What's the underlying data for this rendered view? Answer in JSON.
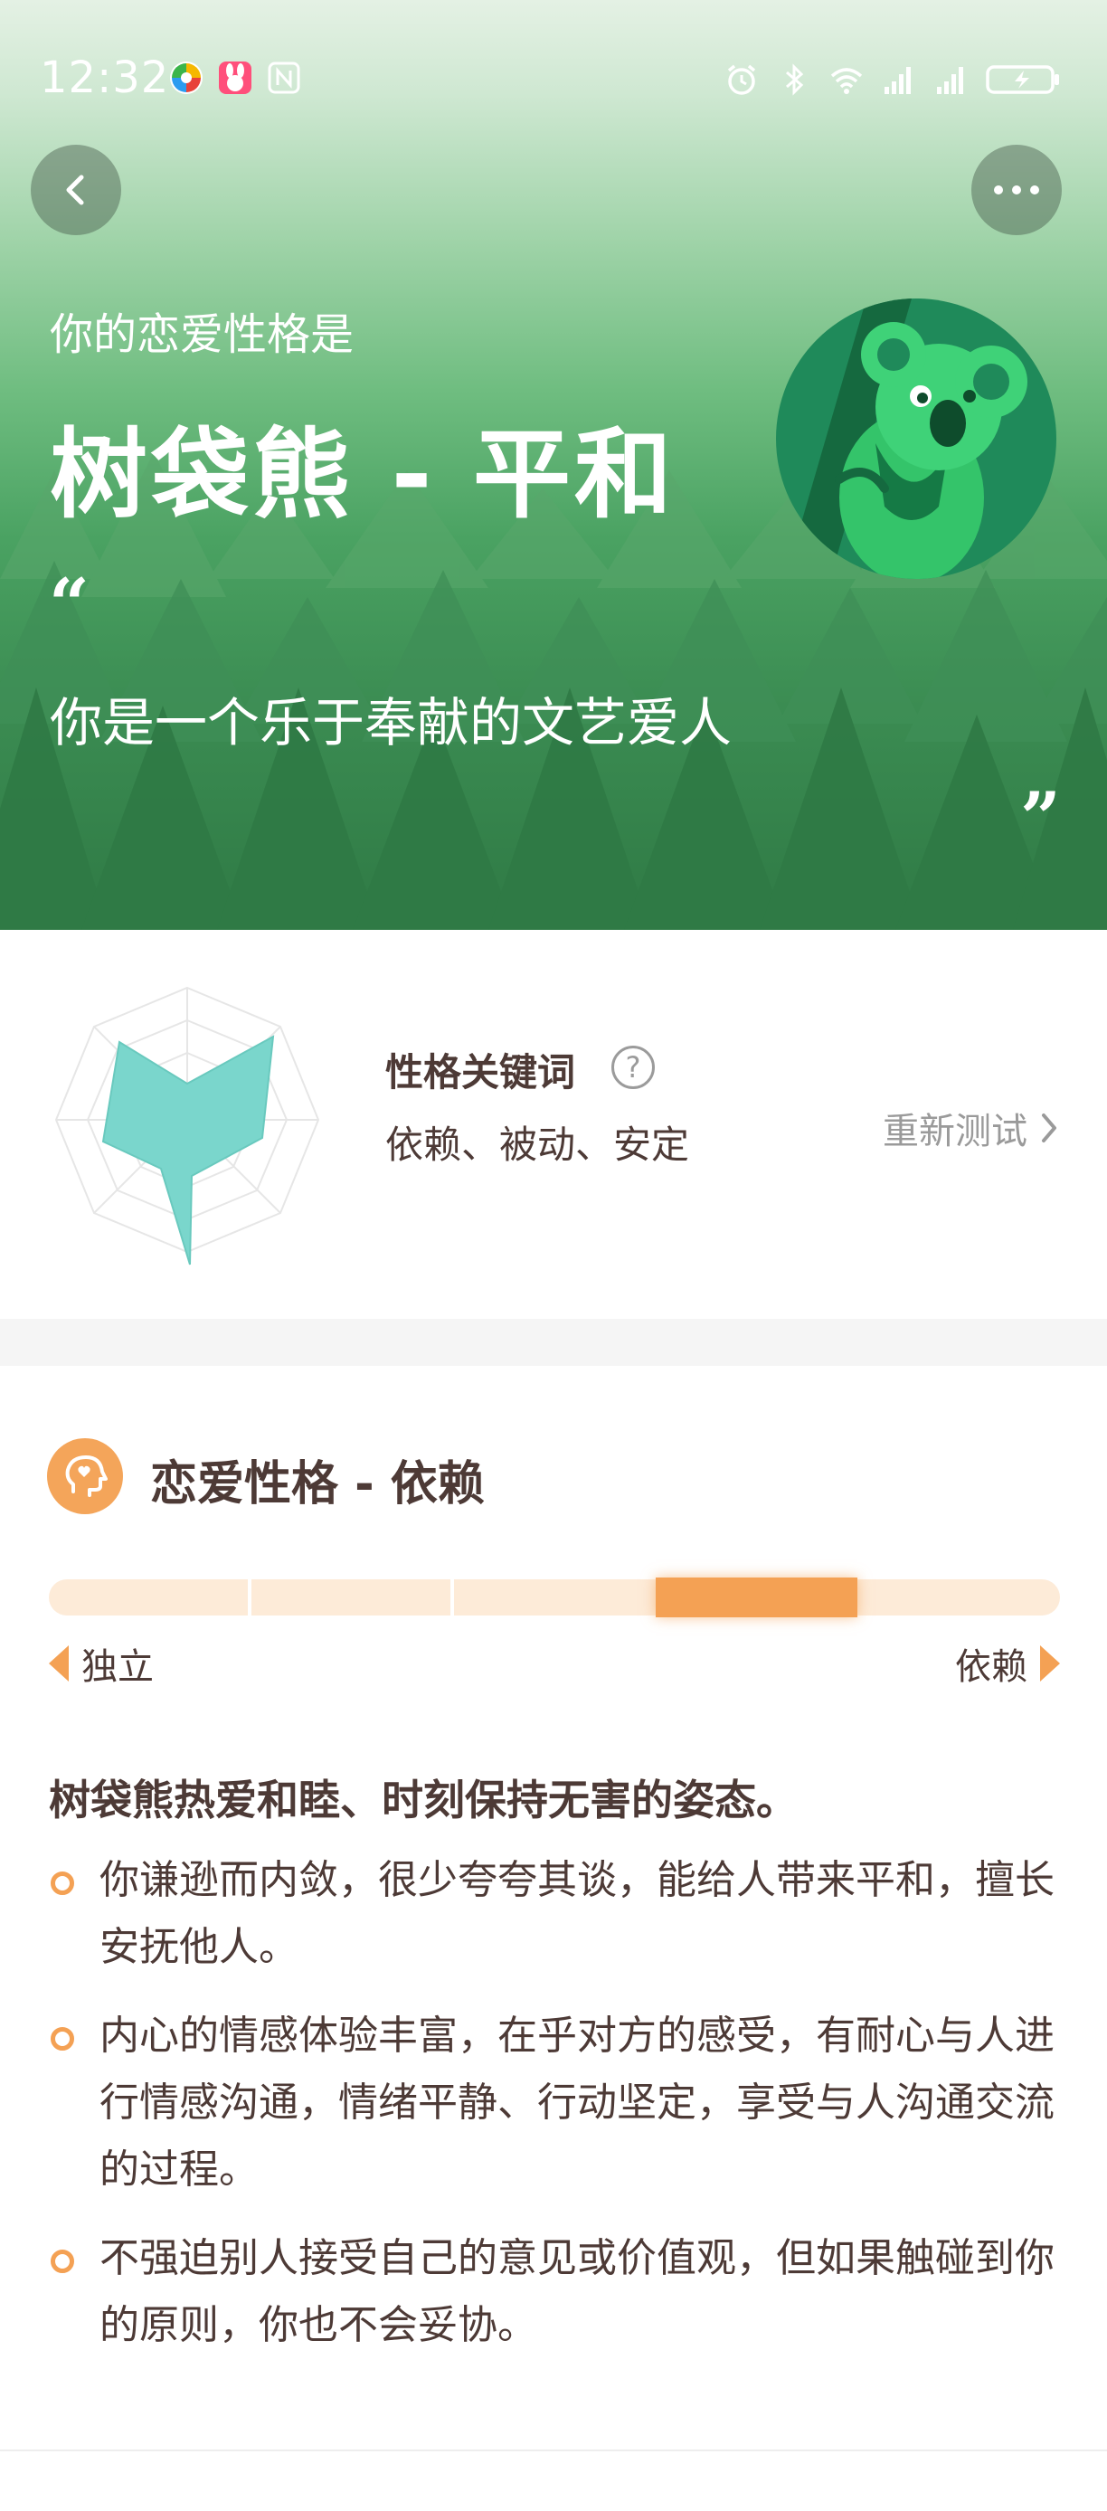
{
  "status_bar": {
    "time": "12:32",
    "left_icons": [
      "app-icon-colorful",
      "app-icon-rabbit",
      "nfc-icon"
    ],
    "right_icons": [
      "alarm-icon",
      "bluetooth-icon",
      "wifi-icon",
      "signal-icon",
      "signal-icon",
      "battery-icon"
    ]
  },
  "header": {
    "back_icon": "chevron-left-icon",
    "more_icon": "more-dots-icon"
  },
  "hero": {
    "subtitle": "你的恋爱性格是",
    "title": "树袋熊 - 平和",
    "quote_open": "“",
    "quote_text": "你是一个乐于奉献的文艺爱人",
    "quote_close": "”",
    "avatar_icon": "koala-avatar",
    "accent_color": "#3aa05a"
  },
  "keywords": {
    "title": "性格关键词",
    "help_icon": "question-circle-icon",
    "help_symbol": "?",
    "values": "依赖、被动、安定",
    "retest_label": "重新测试",
    "retest_icon": "chevron-right-icon",
    "radar_color": "#7ad6cc"
  },
  "personality": {
    "icon": "heart-head-icon",
    "title": "恋爱性格 - 依赖",
    "scale": {
      "left_label": "独立",
      "right_label": "依赖",
      "segments": 5,
      "active_segment": 4,
      "active_color": "#f4a154",
      "track_color": "#fdebd8"
    },
    "summary": "树袋熊热爱和睦、时刻保持无害的姿态。",
    "points": [
      "你谦逊而内敛，很少夸夸其谈，能给人带来平和，擅长安抚他人。",
      "内心的情感体验丰富，在乎对方的感受，有耐心与人进行情感沟通，情绪平静、行动坚定，享受与人沟通交流的过程。",
      "不强迫别人接受自己的意见或价值观，但如果触碰到你的原则，你也不会妥协。"
    ]
  }
}
